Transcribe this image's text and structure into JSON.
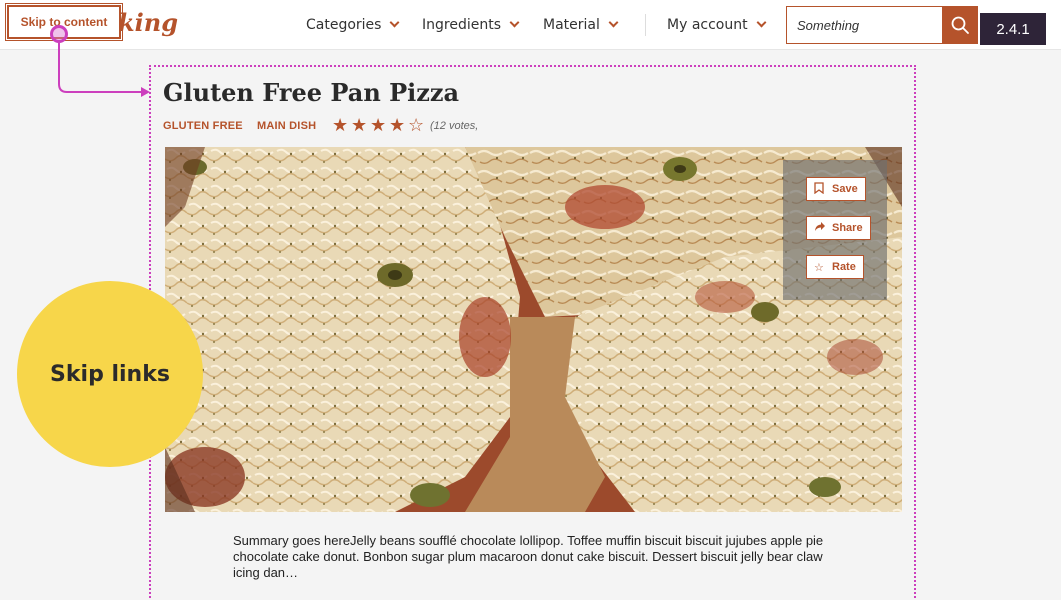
{
  "skip_link": {
    "label": "Skip to content"
  },
  "brand": {
    "logo_text": "king"
  },
  "nav": {
    "items": [
      {
        "label": "Categories"
      },
      {
        "label": "Ingredients"
      },
      {
        "label": "Material"
      },
      {
        "label": "My account"
      }
    ]
  },
  "search": {
    "value": "Something",
    "icon": "search-icon"
  },
  "version_badge": "2.4.1",
  "recipe": {
    "title": "Gluten Free Pan Pizza",
    "tags": [
      "GLUTEN FREE",
      "MAIN DISH"
    ],
    "rating": {
      "value": 4,
      "max": 5
    },
    "votes": "(12 votes,",
    "actions": [
      {
        "label": "Save",
        "icon": "bookmark-icon"
      },
      {
        "label": "Share",
        "icon": "share-arrow-icon"
      },
      {
        "label": "Rate",
        "icon": "star-outline-icon"
      }
    ],
    "summary": "Summary goes hereJelly beans soufflé chocolate lollipop. Toffee muffin biscuit biscuit jujubes apple pie chocolate cake donut. Bonbon sugar plum macaroon donut cake biscuit. Dessert biscuit jelly bear claw icing dan…"
  },
  "annotation": {
    "label": "Skip links"
  },
  "colors": {
    "accent": "#b5532b",
    "focus_outline": "#cc3fbd",
    "callout": "#f7d64a",
    "badge": "#2e2438"
  }
}
